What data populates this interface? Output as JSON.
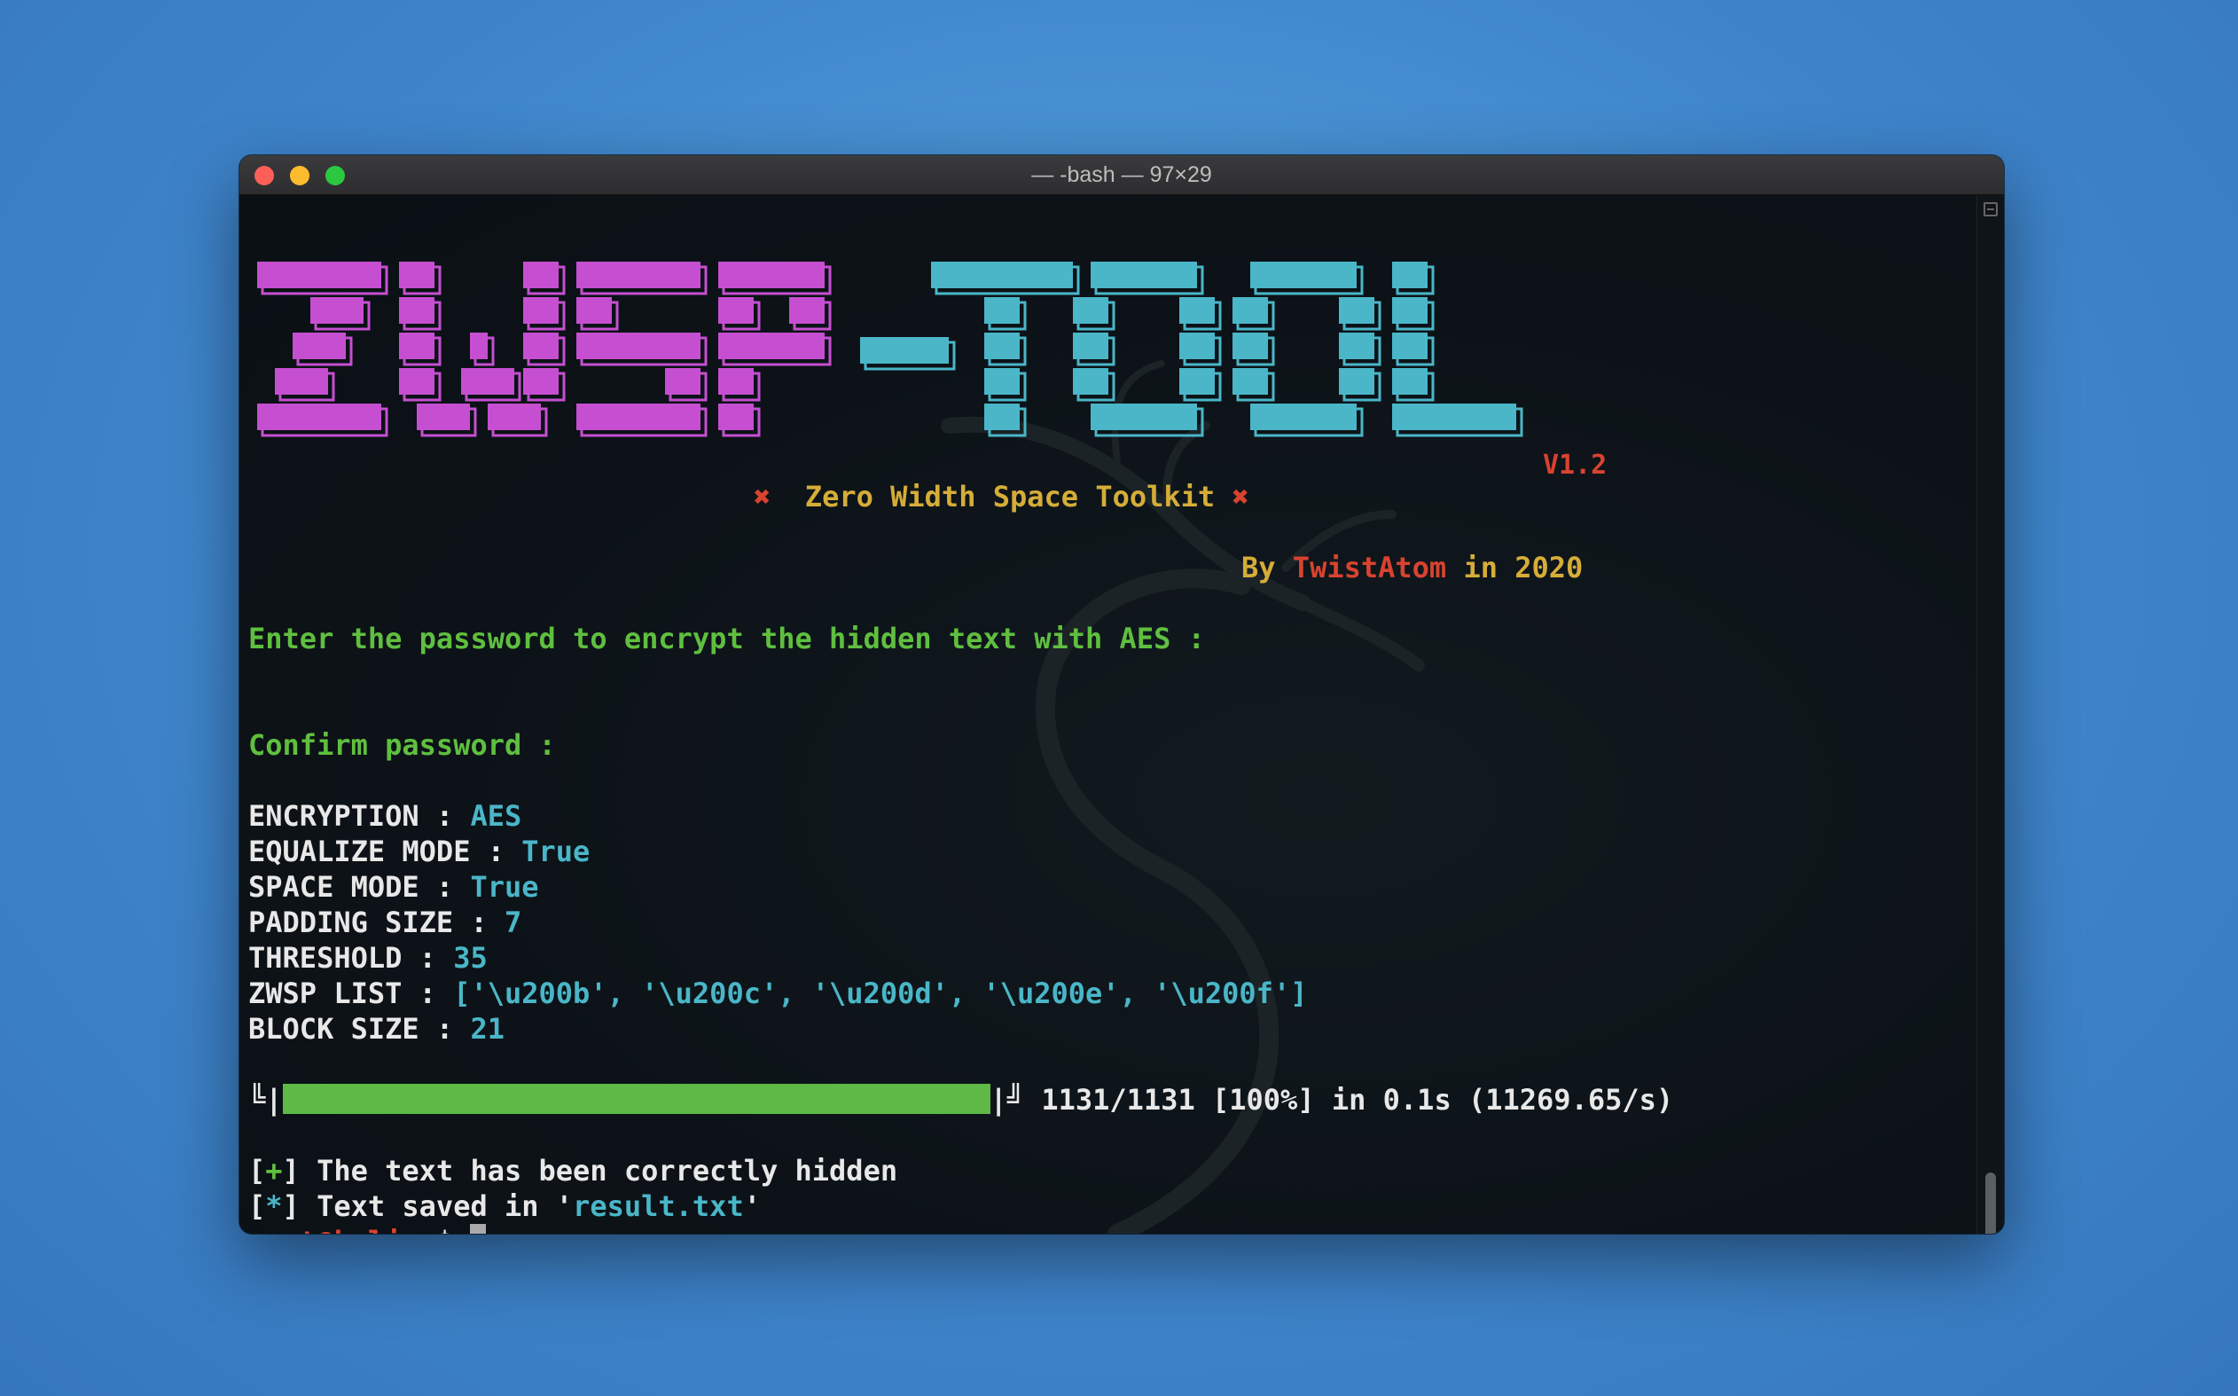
{
  "window": {
    "title": "— -bash — 97×29"
  },
  "banner": {
    "logo_text": "ZWSP-TOOL",
    "version": "V1.2",
    "subtitle": "Zero Width Space Toolkit",
    "cross_glyph": "✖",
    "by_prefix": "By ",
    "author": "TwistAtom",
    "year_suffix": " in 2020",
    "colors": {
      "zwsp": "#c64fd1",
      "tool": "#4ab6c8",
      "version": "#d8432f"
    }
  },
  "prompts": {
    "password": "Enter the password to encrypt the hidden text with AES :",
    "confirm": "Confirm password :"
  },
  "settings": [
    {
      "key": "ENCRYPTION : ",
      "value": "AES"
    },
    {
      "key": "EQUALIZE MODE : ",
      "value": "True"
    },
    {
      "key": "SPACE MODE : ",
      "value": "True"
    },
    {
      "key": "PADDING SIZE : ",
      "value": "7"
    },
    {
      "key": "THRESHOLD : ",
      "value": "35"
    },
    {
      "key": "ZWSP LIST : ",
      "value": "['\\u200b', '\\u200c', '\\u200d', '\\u200e', '\\u200f']"
    },
    {
      "key": "BLOCK SIZE : ",
      "value": "21"
    }
  ],
  "progress": {
    "left_cap": "╚|",
    "right_cap": "|╝",
    "fraction": 1.0,
    "stats": " 1131/1131 [100%] in 0.1s (11269.65/s)"
  },
  "output": {
    "line1_open": "[",
    "line1_sign": "+",
    "line1_text": "] The text has been correctly hidden",
    "line2_open": "[",
    "line2_sign": "*",
    "line2_text": "] Text saved in '",
    "line2_file": "result.txt",
    "line2_close": "'"
  },
  "prompt": {
    "user_host": "root@kali",
    "path": ":~",
    "symbol": "$ "
  }
}
